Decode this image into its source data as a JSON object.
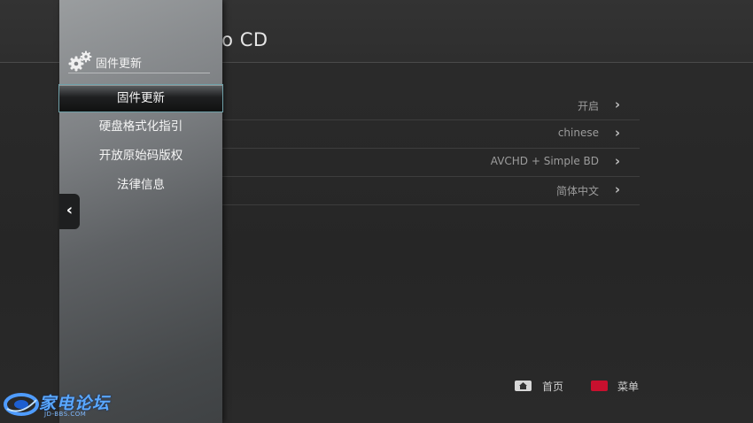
{
  "page": {
    "title": "dio CD"
  },
  "settings": [
    {
      "value": "开启"
    },
    {
      "value": "chinese"
    },
    {
      "value": "AVCHD + Simple BD"
    },
    {
      "value": "简体中文"
    }
  ],
  "panel": {
    "title": "固件更新",
    "items": [
      {
        "label": "固件更新",
        "selected": true
      },
      {
        "label": "硬盘格式化指引",
        "selected": false
      },
      {
        "label": "开放原始码版权",
        "selected": false
      },
      {
        "label": "法律信息",
        "selected": false
      }
    ]
  },
  "footer": {
    "home_label": "首页",
    "menu_label": "菜单"
  },
  "watermark": {
    "text": "家电论坛",
    "sub": "JD-BBS.COM"
  },
  "colors": {
    "selected_border": "#6fa0a8",
    "menu_key": "#c8102e",
    "watermark": "#5aa8ff"
  },
  "icons": {
    "panel_header": "gear-icon",
    "back_tab": "chevron-left-icon",
    "row_arrow": "chevron-right-icon",
    "home_key": "home-icon",
    "menu_key": "red-key-icon"
  }
}
